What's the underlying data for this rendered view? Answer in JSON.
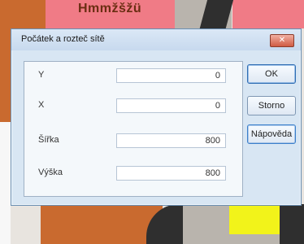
{
  "map": {
    "label": "Hmmžšžü"
  },
  "dialog": {
    "title": "Počátek a rozteč sítě",
    "close_glyph": "✕",
    "fields": [
      {
        "label": "Y",
        "value": "0"
      },
      {
        "label": "X",
        "value": "0"
      },
      {
        "label": "Šířka",
        "value": "800"
      },
      {
        "label": "Výška",
        "value": "800"
      }
    ],
    "buttons": {
      "ok": "OK",
      "cancel": "Storno",
      "help": "Nápověda"
    }
  },
  "colors": {
    "dialog_bg": "#d8e6f3",
    "panel_bg": "#f4f8fb",
    "close_red": "#cf5b43",
    "map_orange": "#c96a2f",
    "map_pink": "#f07b86",
    "map_yellow": "#f2f31a"
  }
}
